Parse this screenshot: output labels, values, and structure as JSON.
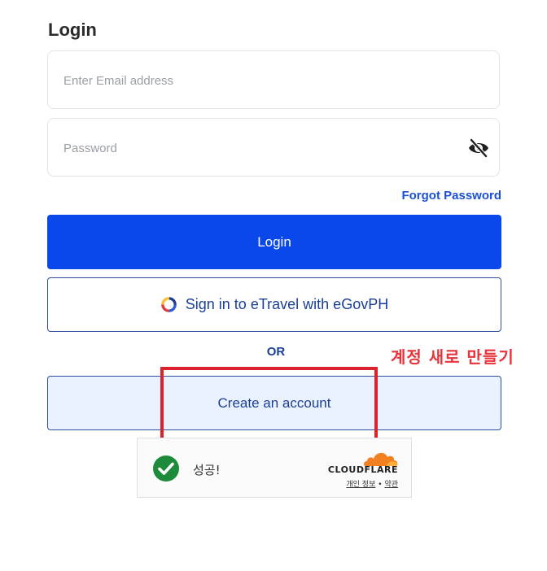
{
  "form": {
    "title": "Login",
    "email_placeholder": "Enter Email address",
    "password_placeholder": "Password",
    "forgot_password": "Forgot Password",
    "login_button": "Login",
    "egov_button": "Sign in to eTravel with eGovPH",
    "or_divider": "OR",
    "create_account_button": "Create an account"
  },
  "annotation": {
    "label": "계정 새로 만들기",
    "color": "#e8323c"
  },
  "captcha": {
    "status": "성공!",
    "brand": "CLOUDFLARE",
    "privacy_link": "개인 정보",
    "separator": "•",
    "terms_link": "약관",
    "success_color": "#1e8a3c",
    "brand_color": "#f38020"
  },
  "colors": {
    "primary": "#0a48ec",
    "accent_text": "#1a3f96",
    "link": "#1a4fd6",
    "create_bg": "#eaf1ff"
  }
}
